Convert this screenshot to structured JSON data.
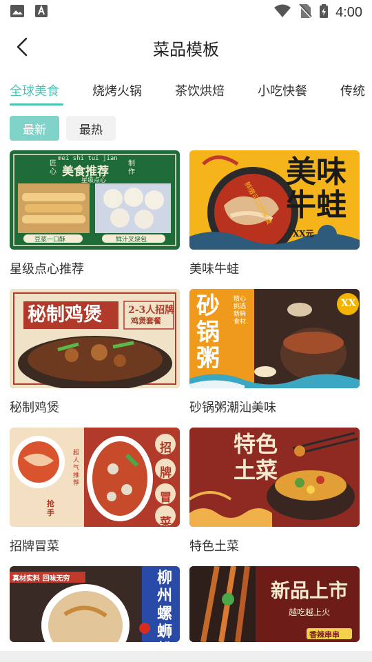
{
  "status": {
    "time": "4:00"
  },
  "header": {
    "title": "菜品模板"
  },
  "tabs": [
    {
      "label": "全球美食",
      "active": true
    },
    {
      "label": "烧烤火锅"
    },
    {
      "label": "茶饮烘焙"
    },
    {
      "label": "小吃快餐"
    },
    {
      "label": "传统"
    }
  ],
  "chips": [
    {
      "label": "最新",
      "active": true
    },
    {
      "label": "最热"
    }
  ],
  "cards": [
    {
      "title": "星级点心推荐",
      "thumb": {
        "bg": "#1f6b37",
        "t1": "美食推荐",
        "t2": "星级点心",
        "t3": "匠心",
        "t4": "制作",
        "t5": "豆浆一口酥",
        "t6": "鲜汁叉烧包",
        "t7": "mei shi tui jian"
      }
    },
    {
      "title": "美味牛蛙",
      "thumb": {
        "bg": "#f4b41a",
        "t1": "美味",
        "t2": "牛蛙",
        "t3": "鲜嫩可口的美食",
        "t4": "XX元"
      }
    },
    {
      "title": "秘制鸡煲",
      "thumb": {
        "bg": "#b23a2a",
        "t1": "秘制鸡煲",
        "t2": "2-3人招牌",
        "t3": "鸡煲套餐"
      }
    },
    {
      "title": "砂锅粥潮汕美味",
      "thumb": {
        "bg": "#f09a1c",
        "t1": "砂锅粥",
        "t2": "XX",
        "t3": "精心挑选新鲜食材"
      }
    },
    {
      "title": "招牌冒菜",
      "thumb": {
        "bg": "#f3e0c2",
        "t1": "招牌冒菜",
        "t2": "超人气推荐",
        "t3": "抢手"
      }
    },
    {
      "title": "特色土菜",
      "thumb": {
        "bg": "#8e2a22",
        "t1": "特色",
        "t2": "土菜"
      }
    },
    {
      "title": "",
      "thumb": {
        "bg": "#ffffff",
        "t1": "柳州螺蛳粉",
        "t2": "真材实料 回味无穷"
      }
    },
    {
      "title": "",
      "thumb": {
        "bg": "#7a1e1a",
        "t1": "新品上市",
        "t2": "越吃越上火",
        "t3": "香辣串串"
      }
    }
  ]
}
